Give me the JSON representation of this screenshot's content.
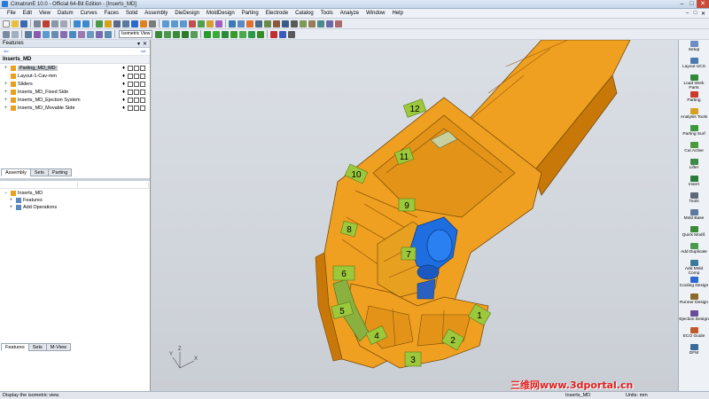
{
  "window": {
    "title": "CimatronE 10.0 - Official 64-Bit Edition - [Inserts_MD]",
    "close_glyph": "✕",
    "min_glyph": "–",
    "max_glyph": "□"
  },
  "menu": [
    "File",
    "Edit",
    "View",
    "Datum",
    "Curves",
    "Faces",
    "Solid",
    "Assembly",
    "DieDesign",
    "MoldDesign",
    "Parting",
    "Electrode",
    "Catalog",
    "Tools",
    "Analyze",
    "Window",
    "Help"
  ],
  "menu_right_ctrls": [
    "–",
    "□",
    "✕"
  ],
  "toolbar": {
    "view_select": "Isometric View"
  },
  "features_panel": {
    "title": "Features",
    "header_ctrls": [
      "▾",
      "✕"
    ],
    "back_arrow": "⇦",
    "forward_arrow": "⇨",
    "root": "Inserts_MD",
    "items": [
      {
        "label": "Parting_MD_MD",
        "selected": true,
        "expander": "+"
      },
      {
        "label": "Layout-1-Cav-mm",
        "selected": false,
        "expander": ""
      },
      {
        "label": "Sliders",
        "selected": false,
        "expander": "+"
      },
      {
        "label": "Inserts_MD_Fixed Side",
        "selected": false,
        "expander": "+"
      },
      {
        "label": "Inserts_MD_Ejection System",
        "selected": false,
        "expander": "+"
      },
      {
        "label": "Inserts_MD_Movable Side",
        "selected": false,
        "expander": "+"
      }
    ],
    "tabs": [
      "Assembly",
      "Sets",
      "Parting"
    ]
  },
  "lower_panel": {
    "root": "Inserts_MD",
    "items": [
      {
        "label": "Features",
        "expander": "+"
      },
      {
        "label": "Add Operations",
        "expander": "+"
      }
    ],
    "tabs": [
      "Features",
      "Sets",
      "M-View"
    ]
  },
  "viewport": {
    "tags": [
      "12",
      "11",
      "10",
      "9",
      "8",
      "7",
      "6",
      "5",
      "4",
      "3",
      "2",
      "1"
    ],
    "axis_labels": {
      "x": "X",
      "y": "Y",
      "z": "Z"
    },
    "colors": {
      "part": "#f0a020",
      "part_dark": "#c87808",
      "slider": "#1e6ee0",
      "tag": "#9cc83c"
    },
    "watermark": "三维网www.3dportal.cn"
  },
  "right_tools": [
    {
      "label": "Setup",
      "color": "#6a8fc0"
    },
    {
      "label": "Layout UCS",
      "color": "#4a7ab0"
    },
    {
      "label": "Load Work Parts",
      "color": "#2f8a3a"
    },
    {
      "label": "Parting",
      "color": "#c83a2a"
    },
    {
      "label": "Analysis Tools",
      "color": "#d6a020"
    },
    {
      "label": "Parting Surf",
      "color": "#3a9a3a"
    },
    {
      "label": "Cut Active",
      "color": "#4a9a3a"
    },
    {
      "label": "Lifter",
      "color": "#3a8a4a"
    },
    {
      "label": "Insert",
      "color": "#2a7a3a"
    },
    {
      "label": "Tools",
      "color": "#5a6a7a"
    },
    {
      "label": "Mold Base",
      "color": "#5a7aa0"
    },
    {
      "label": "Quick Modif.",
      "color": "#3a8a3a"
    },
    {
      "label": "Add Duplicate",
      "color": "#4a9a4a"
    },
    {
      "label": "Add Mold Comp",
      "color": "#3a7a9a"
    },
    {
      "label": "Cooling Design",
      "color": "#2a6ad0"
    },
    {
      "label": "Runner Design",
      "color": "#8a6a2a"
    },
    {
      "label": "Ejection Design",
      "color": "#6a4a9a"
    },
    {
      "label": "ECO Guide",
      "color": "#c05a2a"
    },
    {
      "label": "DFM",
      "color": "#3a6a9a"
    }
  ],
  "status": {
    "message": "Display the isometric view.",
    "document": "Inserts_MD",
    "units": "Units: mm"
  }
}
